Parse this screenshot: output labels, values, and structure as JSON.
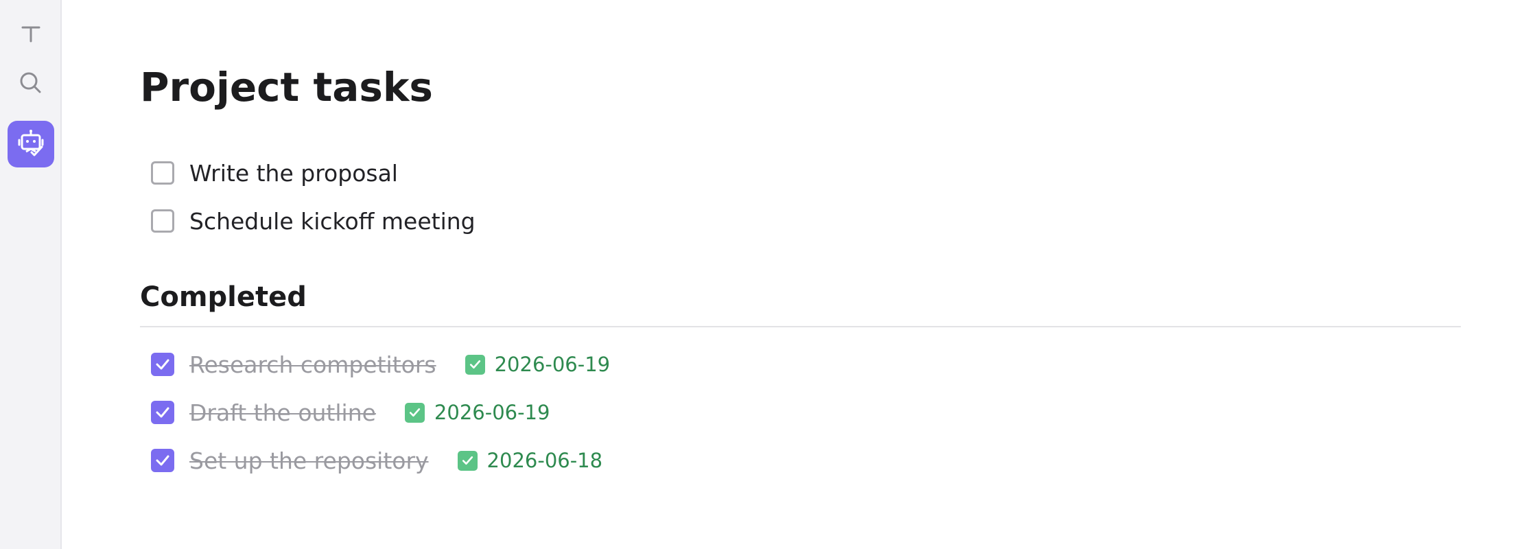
{
  "ribbon": {
    "items": [
      {
        "icon": "text-cursor-icon"
      },
      {
        "icon": "search-icon"
      },
      {
        "icon": "robot-assistant-icon",
        "active": true
      }
    ],
    "accent_color": "#7b6cf0"
  },
  "note": {
    "title": "Project tasks",
    "open_tasks": [
      {
        "text": "Write the proposal",
        "checked": false
      },
      {
        "text": "Schedule kickoff meeting",
        "checked": false
      }
    ],
    "completed_heading": "Completed",
    "completed_tasks": [
      {
        "text": "Research competitors",
        "checked": true,
        "done_date": "2026-06-19"
      },
      {
        "text": "Draft the outline",
        "checked": true,
        "done_date": "2026-06-19"
      },
      {
        "text": "Set up the repository",
        "checked": true,
        "done_date": "2026-06-18"
      }
    ]
  },
  "colors": {
    "accent": "#7b6cf0",
    "done_date": "#2e8a4f",
    "done_icon": "#5cc486"
  }
}
